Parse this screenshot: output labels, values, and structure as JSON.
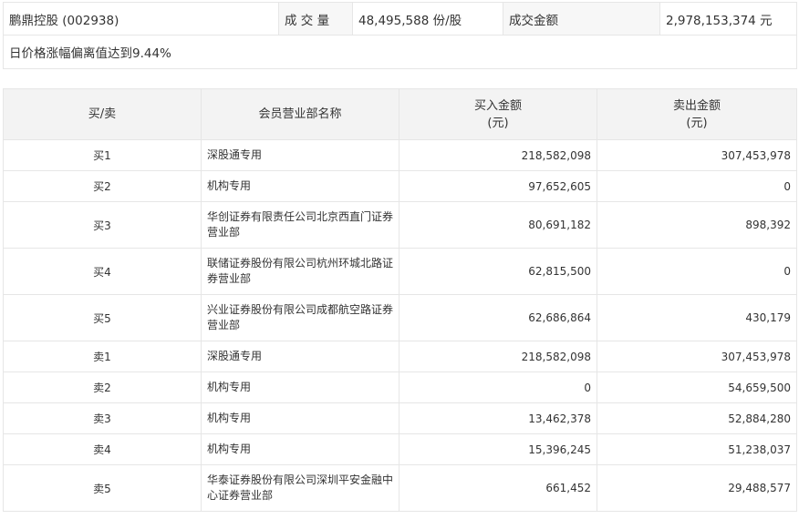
{
  "summary": {
    "stock": "鹏鼎控股 (002938)",
    "volume_label": "成 交 量",
    "volume_value": "48,495,588 份/股",
    "amount_label": "成交金额",
    "amount_value": "2,978,153,374 元",
    "reason": "日价格涨幅偏离值达到9.44%"
  },
  "table": {
    "headers": {
      "side": "买/卖",
      "name": "会员营业部名称",
      "buy": "买入金额",
      "buy_unit": "(元)",
      "sell": "卖出金额",
      "sell_unit": "(元)"
    },
    "rows": [
      {
        "side": "买1",
        "name": "深股通专用",
        "buy": "218,582,098",
        "sell": "307,453,978"
      },
      {
        "side": "买2",
        "name": "机构专用",
        "buy": "97,652,605",
        "sell": "0"
      },
      {
        "side": "买3",
        "name": "华创证券有限责任公司北京西直门证券营业部",
        "buy": "80,691,182",
        "sell": "898,392"
      },
      {
        "side": "买4",
        "name": "联储证券股份有限公司杭州环城北路证券营业部",
        "buy": "62,815,500",
        "sell": "0"
      },
      {
        "side": "买5",
        "name": "兴业证券股份有限公司成都航空路证券营业部",
        "buy": "62,686,864",
        "sell": "430,179"
      },
      {
        "side": "卖1",
        "name": "深股通专用",
        "buy": "218,582,098",
        "sell": "307,453,978"
      },
      {
        "side": "卖2",
        "name": "机构专用",
        "buy": "0",
        "sell": "54,659,500"
      },
      {
        "side": "卖3",
        "name": "机构专用",
        "buy": "13,462,378",
        "sell": "52,884,280"
      },
      {
        "side": "卖4",
        "name": "机构专用",
        "buy": "15,396,245",
        "sell": "51,238,037"
      },
      {
        "side": "卖5",
        "name": "华泰证券股份有限公司深圳平安金融中心证券营业部",
        "buy": "661,452",
        "sell": "29,488,577"
      }
    ]
  }
}
